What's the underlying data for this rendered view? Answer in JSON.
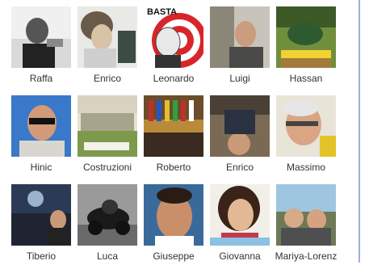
{
  "friends": [
    {
      "name": "Raffa"
    },
    {
      "name": "Enrico"
    },
    {
      "name": "Leonardo"
    },
    {
      "name": "Luigi"
    },
    {
      "name": "Hassan"
    },
    {
      "name": "Hinic"
    },
    {
      "name": "Costruzioni"
    },
    {
      "name": "Roberto"
    },
    {
      "name": "Enrico"
    },
    {
      "name": "Massimo"
    },
    {
      "name": "Tiberio"
    },
    {
      "name": "Luca"
    },
    {
      "name": "Giuseppe"
    },
    {
      "name": "Giovanna"
    },
    {
      "name": "Mariya-Lorenz"
    }
  ],
  "thumb_text": {
    "leonardo_banner": "BASTA"
  },
  "colors": {
    "rule": "#9fb0d6",
    "label": "#333333"
  }
}
